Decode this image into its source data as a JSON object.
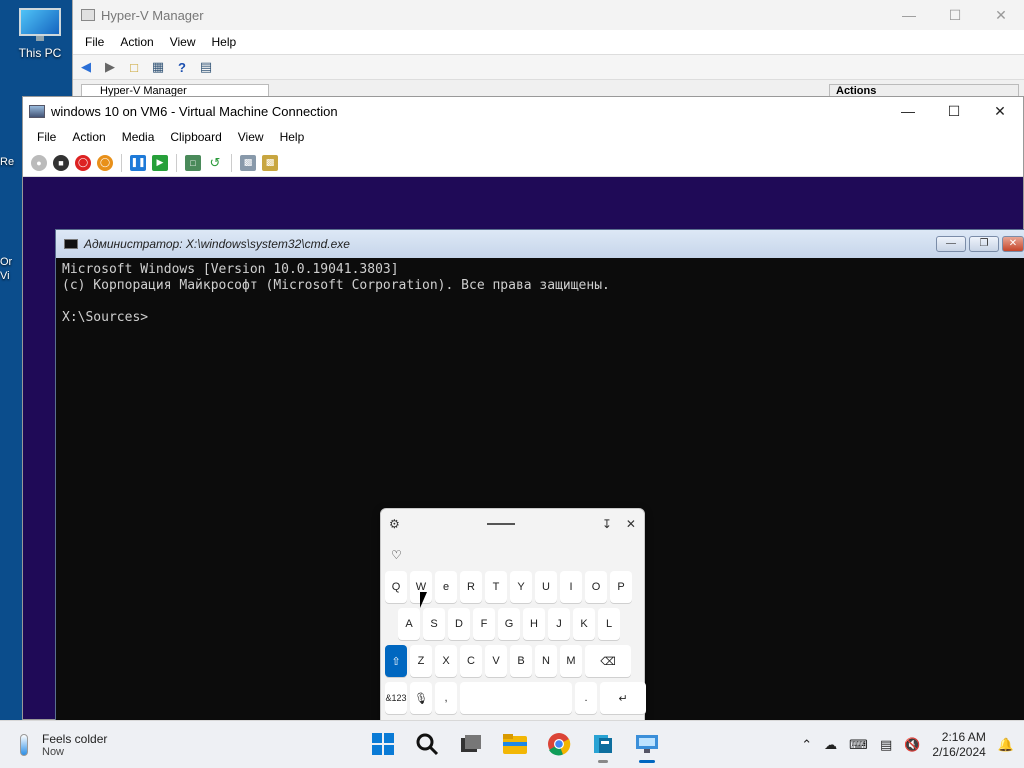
{
  "desktop": {
    "this_pc_label": "This PC",
    "side_labels": [
      "Re",
      "Or",
      "Vi"
    ]
  },
  "hyperv": {
    "title": "Hyper-V Manager",
    "menu": [
      "File",
      "Action",
      "View",
      "Help"
    ],
    "tree_label": "Hyper-V Manager",
    "actions_label": "Actions"
  },
  "vm": {
    "title": "windows 10 on VM6 - Virtual Machine Connection",
    "menu": [
      "File",
      "Action",
      "Media",
      "Clipboard",
      "View",
      "Help"
    ]
  },
  "cmd": {
    "title": "Администратор: X:\\windows\\system32\\cmd.exe",
    "lines": [
      "Microsoft Windows [Version 10.0.19041.3803]",
      "(c) Корпорация Майкрософт (Microsoft Corporation). Все права защищены.",
      "",
      "X:\\Sources>"
    ]
  },
  "keyboard": {
    "row1": [
      "Q",
      "W",
      "e",
      "R",
      "T",
      "Y",
      "U",
      "I",
      "O",
      "P"
    ],
    "row2": [
      "A",
      "S",
      "D",
      "F",
      "G",
      "H",
      "J",
      "K",
      "L"
    ],
    "row3": [
      "Z",
      "X",
      "C",
      "V",
      "B",
      "N",
      "M"
    ],
    "symbols_key": "&123",
    "comma_key": ",",
    "period_key": ".",
    "question_hint": "?"
  },
  "taskbar": {
    "weather_text": "Feels colder",
    "weather_sub": "Now",
    "time": "2:16 AM",
    "date": "2/16/2024"
  }
}
